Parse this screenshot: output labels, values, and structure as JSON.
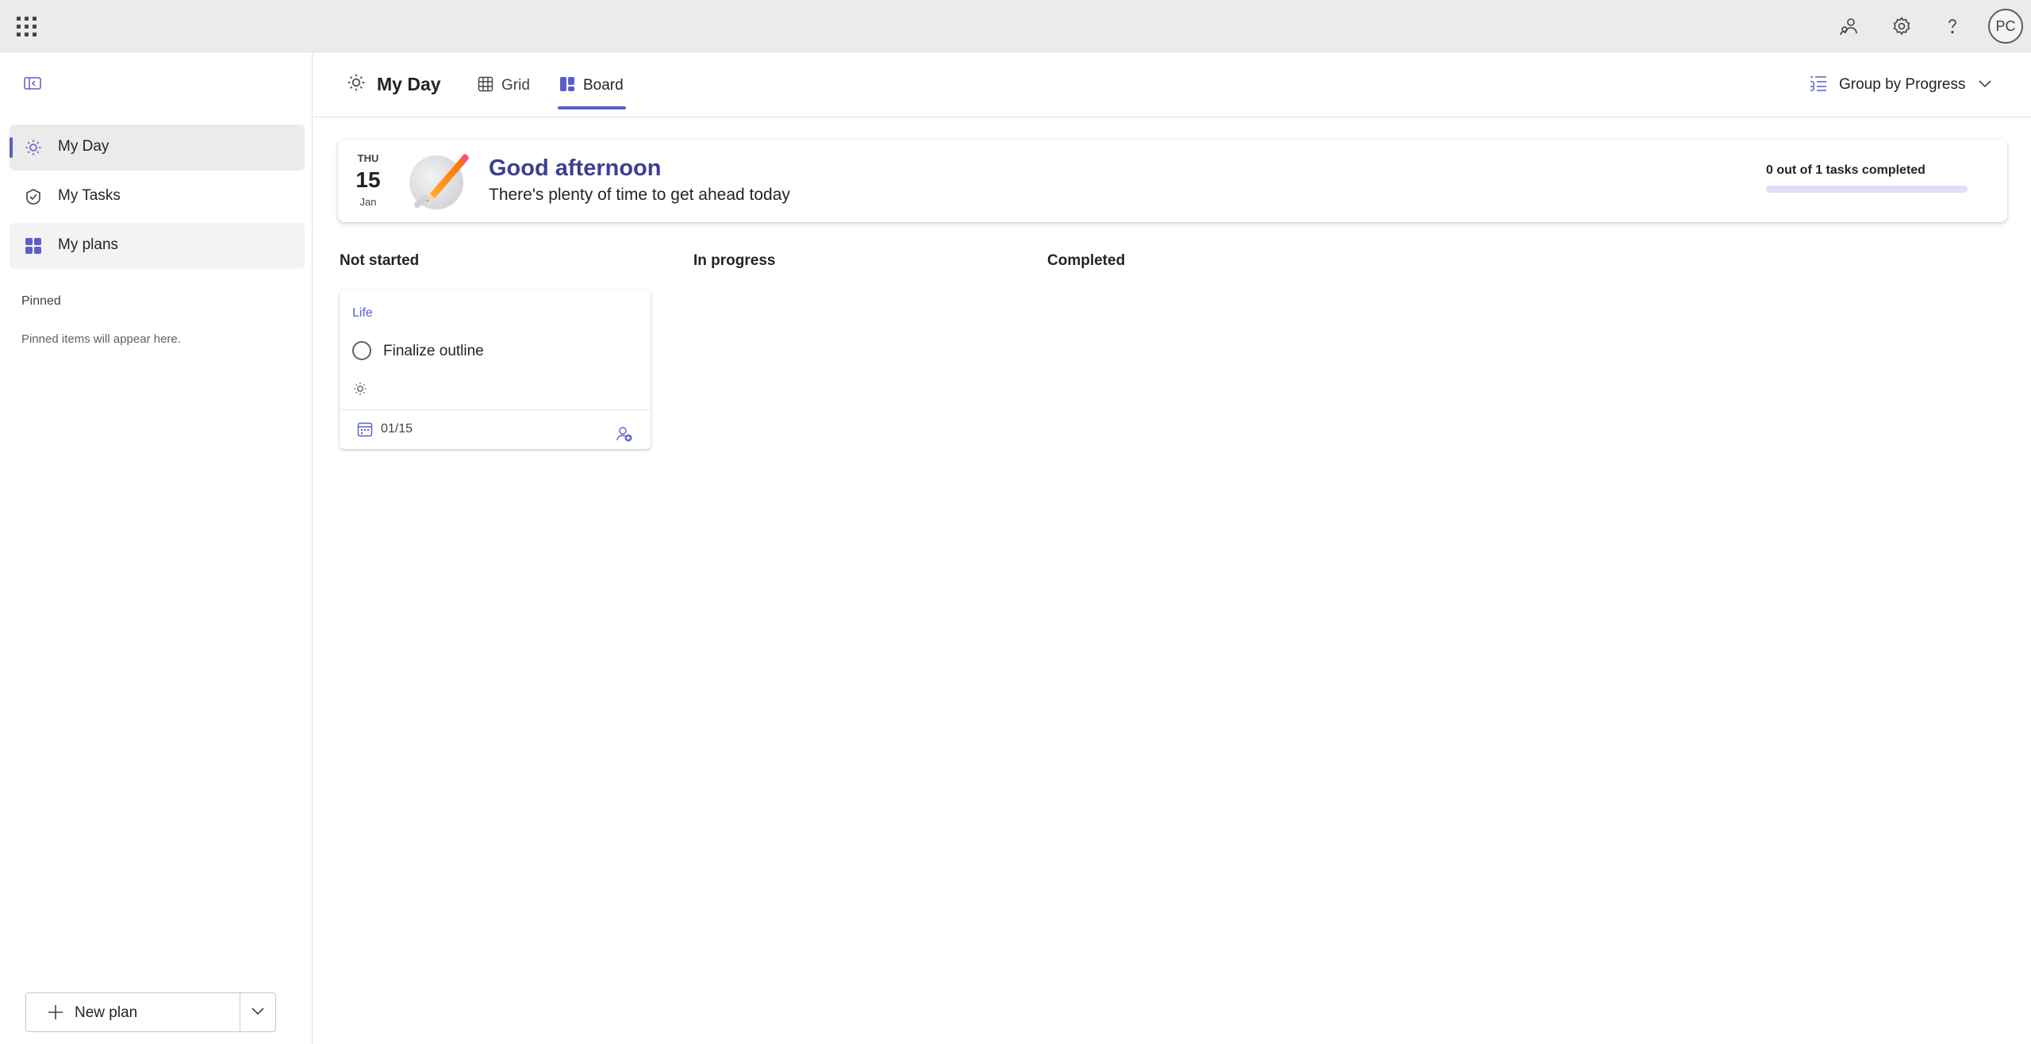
{
  "topbar": {
    "avatar_initials": "PC",
    "icons": [
      "app-launcher-icon",
      "share-people-icon",
      "settings-gear-icon",
      "help-question-icon"
    ]
  },
  "sidebar": {
    "items": [
      {
        "label": "My Day",
        "icon": "sun-icon",
        "state": "active"
      },
      {
        "label": "My Tasks",
        "icon": "tasks-check-icon",
        "state": "default"
      },
      {
        "label": "My plans",
        "icon": "plans-grid-icon",
        "state": "hover"
      }
    ],
    "pinned_title": "Pinned",
    "pinned_empty": "Pinned items will appear here.",
    "new_plan_label": "New plan"
  },
  "header": {
    "title": "My Day",
    "tabs": [
      {
        "label": "Grid",
        "active": false
      },
      {
        "label": "Board",
        "active": true
      }
    ],
    "group_by_label": "Group by Progress"
  },
  "banner": {
    "day_of_week": "THU",
    "day": "15",
    "month": "Jan",
    "greeting": "Good afternoon",
    "subtitle": "There's plenty of time to get ahead today",
    "progress_text": "0 out of 1 tasks completed",
    "progress_fraction": 0
  },
  "board": {
    "columns": [
      {
        "title": "Not started"
      },
      {
        "title": "In progress"
      },
      {
        "title": "Completed"
      }
    ],
    "card": {
      "plan": "Life",
      "title": "Finalize outline",
      "due_date": "01/15"
    }
  },
  "colors": {
    "accent": "#5b5fc7",
    "greeting": "#3d3e93",
    "topbar_bg": "#ebebeb"
  }
}
